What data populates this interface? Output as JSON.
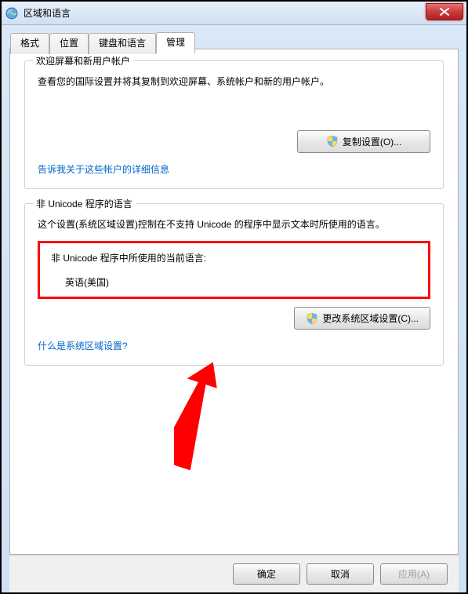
{
  "titlebar": {
    "title": "区域和语言"
  },
  "tabs": {
    "format": "格式",
    "location": "位置",
    "keyboard": "键盘和语言",
    "admin": "管理"
  },
  "section1": {
    "legend": "欢迎屏幕和新用户帐户",
    "desc": "查看您的国际设置并将其复制到欢迎屏幕、系统帐户和新的用户帐户。",
    "copy_btn": "复制设置(O)...",
    "link": "告诉我关于这些帐户的详细信息"
  },
  "section2": {
    "legend": "非 Unicode 程序的语言",
    "desc": "这个设置(系统区域设置)控制在不支持 Unicode 的程序中显示文本时所使用的语言。",
    "current_label": "非 Unicode 程序中所使用的当前语言:",
    "current_value": "英语(美国)",
    "change_btn": "更改系统区域设置(C)...",
    "link": "什么是系统区域设置?"
  },
  "buttons": {
    "ok": "确定",
    "cancel": "取消",
    "apply": "应用(A)"
  }
}
